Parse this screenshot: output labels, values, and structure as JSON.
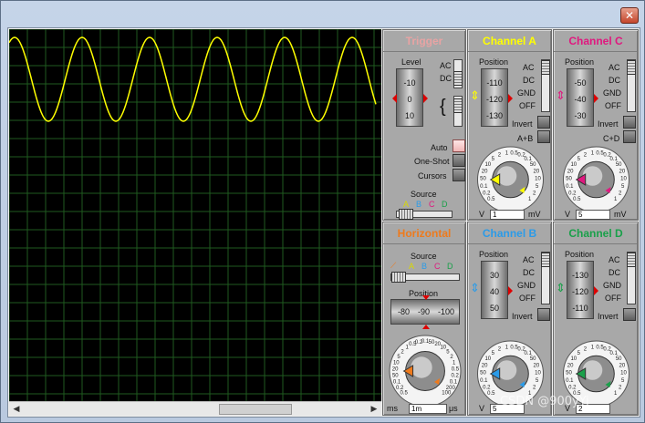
{
  "window": {
    "close_label": "✕"
  },
  "trigger": {
    "title": "Trigger",
    "title_color": "#e8a3a3",
    "level_label": "Level",
    "level_ticks": [
      "-10",
      "0",
      "10"
    ],
    "coupling": [
      "AC",
      "DC"
    ],
    "modes": [
      "Auto",
      "One-Shot",
      "Cursors"
    ],
    "source_label": "Source",
    "source_channels": [
      "A",
      "B",
      "C",
      "D"
    ]
  },
  "channel_a": {
    "title": "Channel A",
    "color": "#ffff00",
    "position_label": "Position",
    "position_ticks": [
      "-110",
      "-120",
      "-130"
    ],
    "coupling": [
      "AC",
      "DC",
      "GND",
      "OFF"
    ],
    "invert_label": "Invert",
    "combine_label": "A+B",
    "knob_value": "1",
    "knob_unit": "mV",
    "knob_left_unit": "V"
  },
  "channel_c": {
    "title": "Channel C",
    "color": "#e0187f",
    "position_label": "Position",
    "position_ticks": [
      "-50",
      "-40",
      "-30"
    ],
    "coupling": [
      "AC",
      "DC",
      "GND",
      "OFF"
    ],
    "invert_label": "Invert",
    "combine_label": "C+D",
    "knob_value": "5",
    "knob_unit": "mV",
    "knob_left_unit": "V"
  },
  "horizontal": {
    "title": "Horizontal",
    "color": "#ee7a1c",
    "source_label": "Source",
    "source_channels": [
      "A",
      "B",
      "C",
      "D"
    ],
    "position_label": "Position",
    "position_ticks": [
      "-80",
      "-90",
      "-100"
    ],
    "knob_value": "1m",
    "knob_unit": "μs",
    "knob_left_unit": "ms"
  },
  "channel_b": {
    "title": "Channel B",
    "color": "#2b9be8",
    "position_label": "Position",
    "position_ticks": [
      "30",
      "40",
      "50"
    ],
    "coupling": [
      "AC",
      "DC",
      "GND",
      "OFF"
    ],
    "invert_label": "Invert",
    "knob_value": "5",
    "knob_left_unit": "V"
  },
  "channel_d": {
    "title": "Channel D",
    "color": "#1aa04a",
    "position_label": "Position",
    "position_ticks": [
      "-130",
      "-120",
      "-110"
    ],
    "coupling": [
      "AC",
      "DC",
      "GND",
      "OFF"
    ],
    "invert_label": "Invert",
    "knob_value": "2",
    "knob_left_unit": "V"
  },
  "dial_scale": [
    "0.5",
    "0.2",
    "0.1",
    "50",
    "20",
    "10",
    "5",
    "2",
    "1",
    "0.5",
    "0.2",
    "0.1",
    "50",
    "20",
    "10",
    "5",
    "2",
    "1"
  ],
  "time_dial_scale": [
    "0.5",
    "0.2",
    "0.1",
    "50",
    "20",
    "10",
    "5",
    "2",
    "1",
    "0.5",
    "0.2",
    "0.1",
    "50",
    "20",
    "10",
    "5",
    "2",
    "1",
    "0.5",
    "0.2",
    "0.1",
    "200",
    "100"
  ],
  "watermark": "CSDN @900yYi"
}
